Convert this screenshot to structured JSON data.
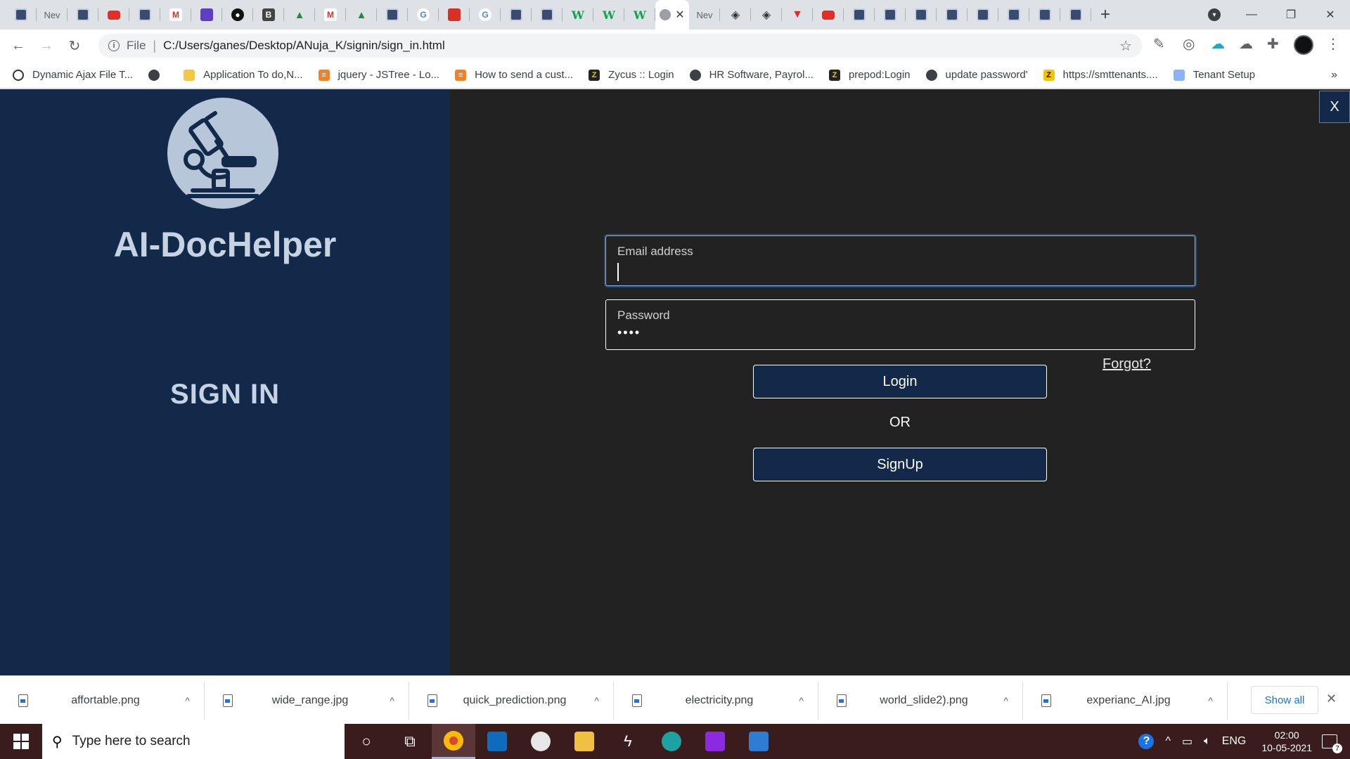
{
  "browser": {
    "tabs": [
      {
        "icon": "globe-icon",
        "text": ""
      },
      {
        "icon": "",
        "text": "Nev"
      },
      {
        "icon": "globe-icon",
        "text": ""
      },
      {
        "icon": "youtube-icon",
        "text": ""
      },
      {
        "icon": "globe-icon",
        "text": ""
      },
      {
        "icon": "gmail-icon",
        "text": ""
      },
      {
        "icon": "doc-icon",
        "text": ""
      },
      {
        "icon": "github-icon",
        "text": ""
      },
      {
        "icon": "b-icon",
        "text": ""
      },
      {
        "icon": "drive-icon",
        "text": ""
      },
      {
        "icon": "gmail-icon",
        "text": ""
      },
      {
        "icon": "drive-icon",
        "text": ""
      },
      {
        "icon": "globe-icon",
        "text": ""
      },
      {
        "icon": "google-icon",
        "text": ""
      },
      {
        "icon": "red-app-icon",
        "text": ""
      },
      {
        "icon": "google-icon",
        "text": ""
      },
      {
        "icon": "globe-icon",
        "text": ""
      },
      {
        "icon": "globe-icon",
        "text": ""
      },
      {
        "icon": "w-icon",
        "text": ""
      },
      {
        "icon": "w-icon",
        "text": ""
      },
      {
        "icon": "w-icon",
        "text": ""
      },
      {
        "icon": "dot-icon",
        "text": "",
        "active": true
      },
      {
        "icon": "",
        "text": "Nev"
      },
      {
        "icon": "diamond-icon",
        "text": ""
      },
      {
        "icon": "diamond-icon",
        "text": ""
      },
      {
        "icon": "v-icon",
        "text": ""
      },
      {
        "icon": "youtube-icon",
        "text": ""
      },
      {
        "icon": "globe-icon",
        "text": ""
      },
      {
        "icon": "globe-icon",
        "text": ""
      },
      {
        "icon": "globe-icon",
        "text": ""
      },
      {
        "icon": "globe-icon",
        "text": ""
      },
      {
        "icon": "globe-icon",
        "text": ""
      },
      {
        "icon": "globe-icon",
        "text": ""
      },
      {
        "icon": "globe-icon",
        "text": ""
      },
      {
        "icon": "globe-icon",
        "text": ""
      }
    ],
    "new_tab": "+",
    "address": {
      "scheme": "File",
      "url": "C:/Users/ganes/Desktop/ANuja_K/signin/sign_in.html"
    },
    "bookmarks": [
      {
        "label": "Dynamic Ajax File T...",
        "icon": "spinner-icon"
      },
      {
        "label": "",
        "icon": "globe-icon"
      },
      {
        "label": "Application To do,N...",
        "icon": "folder-icon"
      },
      {
        "label": "jquery - JSTree - Lo...",
        "icon": "stackoverflow-icon"
      },
      {
        "label": "How to send a cust...",
        "icon": "stackoverflow-icon"
      },
      {
        "label": "Zycus :: Login",
        "icon": "z-icon"
      },
      {
        "label": "HR Software, Payrol...",
        "icon": "globe-icon"
      },
      {
        "label": "prepod:Login",
        "icon": "z-icon"
      },
      {
        "label": "update password'",
        "icon": "globe-icon"
      },
      {
        "label": "https://smttenants....",
        "icon": "z-yellow-icon"
      },
      {
        "label": "Tenant Setup",
        "icon": "image-icon"
      }
    ],
    "bookmarks_more": "»"
  },
  "page": {
    "app_title": "AI-DocHelper",
    "signin_title": "SIGN IN",
    "close_label": "X",
    "email": {
      "label": "Email address",
      "value": ""
    },
    "password": {
      "label": "Password",
      "value": "••••"
    },
    "forgot": "Forgot?",
    "login_label": "Login",
    "or_label": "OR",
    "signup_label": "SignUp"
  },
  "downloads": {
    "items": [
      "affortable.png",
      "wide_range.jpg",
      "quick_prediction.png",
      "electricity.png",
      "world_slide2).png",
      "experianc_AI.jpg"
    ],
    "show_all": "Show all"
  },
  "taskbar": {
    "search_placeholder": "Type here to search",
    "language": "ENG",
    "time": "02:00",
    "date": "10-05-2021",
    "notification_count": "7"
  },
  "colors": {
    "left_panel": "#12294a",
    "right_panel": "#222222",
    "title_text": "#c6d3e3"
  }
}
